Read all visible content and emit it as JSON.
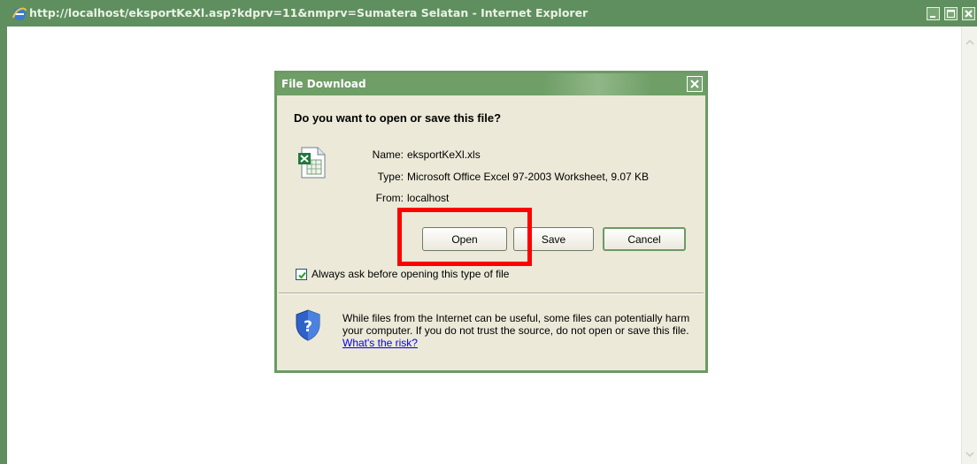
{
  "window": {
    "title": "http://localhost/eksportKeXl.asp?kdprv=11&nmprv=Sumatera Selatan - Internet Explorer",
    "icon": "ie-icon",
    "controls": [
      "minimize-icon",
      "maximize-icon",
      "close-icon"
    ]
  },
  "dialog": {
    "title": "File Download",
    "question": "Do you want to open or save this file?",
    "file_icon": "excel-file-icon",
    "info": {
      "name_label": "Name:",
      "name_value": "eksportKeXl.xls",
      "type_label": "Type:",
      "type_value": "Microsoft Office Excel 97-2003 Worksheet, 9.07 KB",
      "from_label": "From:",
      "from_value": "localhost"
    },
    "buttons": {
      "open": "Open",
      "save": "Save",
      "cancel": "Cancel"
    },
    "checkbox": {
      "label": "Always ask before opening this type of file",
      "checked": true
    },
    "warning": {
      "icon": "shield-question-icon",
      "text": "While files from the Internet can be useful, some files can potentially harm your computer. If you do not trust the source, do not open or save this file.",
      "link": "What's the risk?"
    }
  },
  "colors": {
    "title_bar": "#5f8f5f",
    "dialog_face": "#ece9d8",
    "highlight": "#ff0000",
    "link": "#0000ee"
  }
}
